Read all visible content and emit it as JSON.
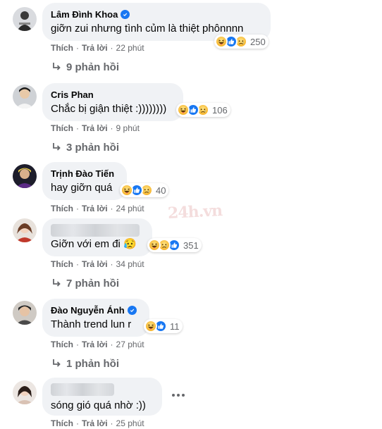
{
  "labels": {
    "like": "Thích",
    "reply": "Trả lời"
  },
  "colors": {
    "accent": "#1877f2",
    "bubble": "#f0f2f5",
    "meta": "#65676b"
  },
  "watermark_text": "24h.vn",
  "comments": [
    {
      "author": "Lâm Đình Khoa",
      "verified": true,
      "text": "giỡn zui nhưng tình củm là thiệt phônnnn",
      "reactions": [
        "haha",
        "like",
        "sad"
      ],
      "reaction_count": "250",
      "time": "22 phút",
      "replies": "9 phản hồi"
    },
    {
      "author": "Cris Phan",
      "verified": false,
      "text": "Chắc bị giận thiệt :))))))))",
      "reactions": [
        "haha",
        "like",
        "sad"
      ],
      "reaction_count": "106",
      "time": "9 phút",
      "replies": "3 phản hồi"
    },
    {
      "author": "Trịnh Đào Tiến",
      "verified": false,
      "text": "hay giỡn quá",
      "reactions": [
        "haha",
        "like",
        "sad"
      ],
      "reaction_count": "40",
      "time": "24 phút",
      "replies": ""
    },
    {
      "author": "",
      "verified": false,
      "author_hidden": true,
      "text": "Giỡn với em đi 😥",
      "reactions": [
        "haha",
        "sad",
        "like"
      ],
      "reaction_count": "351",
      "time": "34 phút",
      "replies": "7 phản hồi"
    },
    {
      "author": "Đào Nguyễn Ánh",
      "verified": true,
      "text": "Thành trend lun r",
      "reactions": [
        "haha",
        "like"
      ],
      "reaction_count": "11",
      "time": "27 phút",
      "replies": "1 phản hồi"
    },
    {
      "author": "",
      "verified": false,
      "author_hidden": true,
      "text": "sóng gió quá nhờ :))",
      "reactions": [],
      "reaction_count": "",
      "time": "25 phút",
      "replies": ""
    }
  ]
}
